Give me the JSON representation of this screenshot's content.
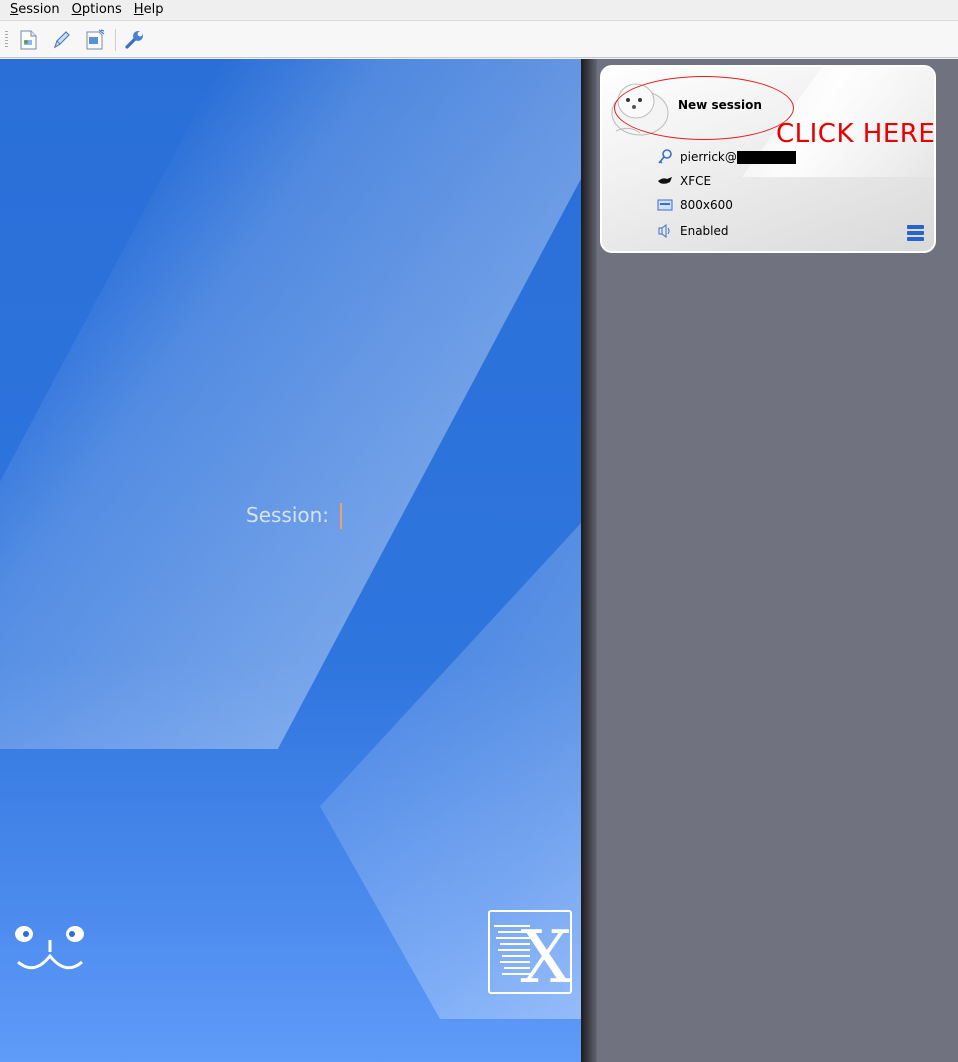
{
  "menubar": {
    "items": [
      {
        "accel": "S",
        "rest": "ession"
      },
      {
        "accel": "O",
        "rest": "ptions"
      },
      {
        "accel": "H",
        "rest": "elp"
      }
    ]
  },
  "toolbar": {
    "buttons": [
      "new-session-icon",
      "edit-session-icon",
      "session-export-icon",
      "preferences-wrench-icon"
    ]
  },
  "login": {
    "label": "Session:",
    "value": ""
  },
  "session_card": {
    "title": "New session",
    "user": "pierrick@",
    "desktop": "XFCE",
    "resolution": "800x600",
    "sound": "Enabled"
  },
  "annotation": {
    "text": "CLICK HERE",
    "color": "#e80000"
  },
  "colors": {
    "accent": "#2a64c8",
    "session_bg": "#2f75de",
    "side_bg": "#70727f"
  }
}
